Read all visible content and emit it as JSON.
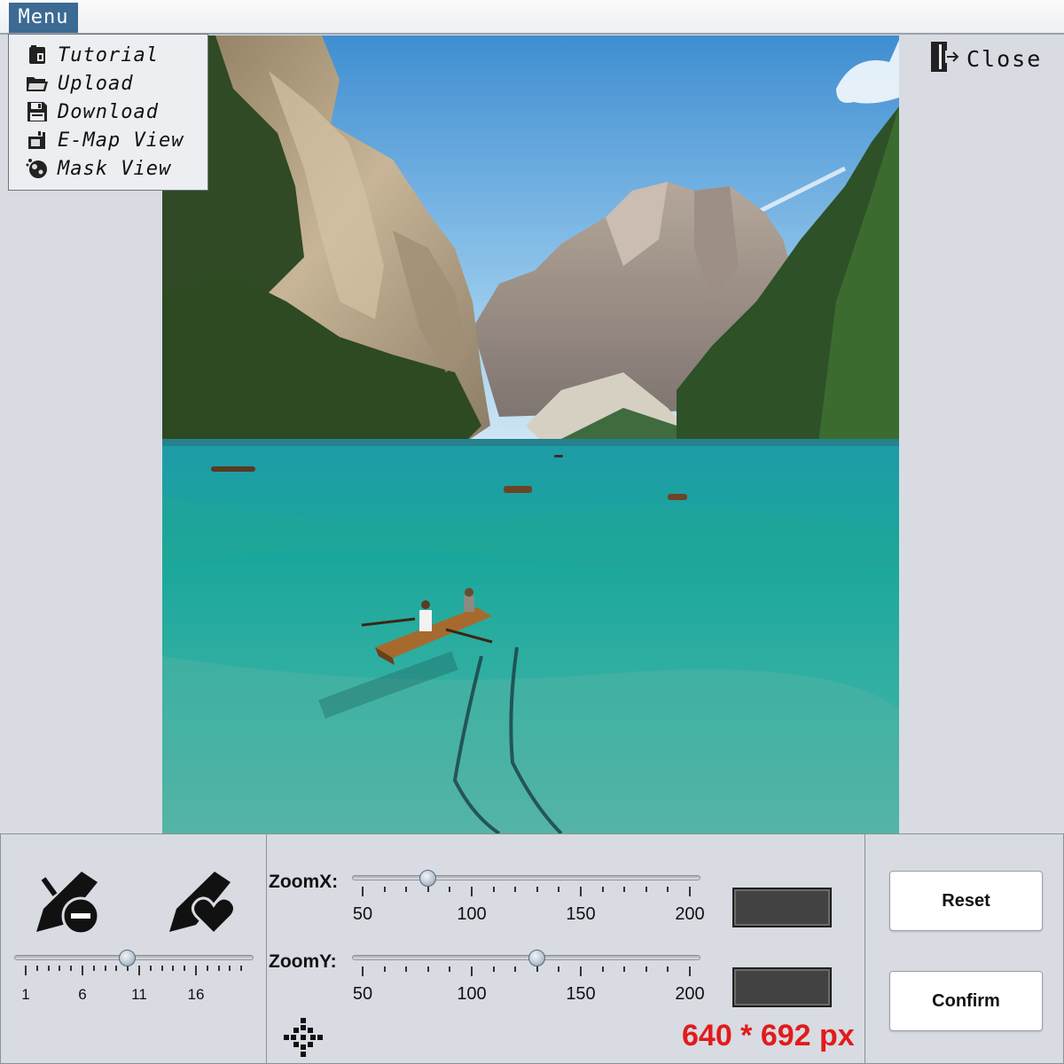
{
  "menu": {
    "label": "Menu",
    "items": [
      {
        "label": "Tutorial",
        "icon": "tutorial-icon"
      },
      {
        "label": "Upload",
        "icon": "folder-icon"
      },
      {
        "label": "Download",
        "icon": "floppy-disk-icon"
      },
      {
        "label": "E-Map View",
        "icon": "emap-icon"
      },
      {
        "label": "Mask View",
        "icon": "mask-icon"
      }
    ]
  },
  "close": {
    "label": "Close",
    "icon": "exit-door-icon"
  },
  "brush": {
    "erase_icon": "pen-minus-icon",
    "paint_icon": "pen-heart-icon",
    "size_slider": {
      "min": 1,
      "max": 20,
      "value": 10,
      "tick_labels": [
        "1",
        "6",
        "11",
        "16"
      ]
    }
  },
  "zoom": {
    "x": {
      "label": "ZoomX:",
      "min": 50,
      "max": 200,
      "value": 80,
      "tick_labels": [
        "50",
        "100",
        "150",
        "200"
      ]
    },
    "y": {
      "label": "ZoomY:",
      "min": 50,
      "max": 200,
      "value": 130,
      "tick_labels": [
        "50",
        "100",
        "150",
        "200"
      ]
    },
    "crosshair_icon": "move-crosshair-icon",
    "dimensions": "640 * 692 px",
    "colors": {
      "dimensions_text": "#e21b1b",
      "fields": "#424242"
    }
  },
  "actions": {
    "reset": "Reset",
    "confirm": "Confirm"
  },
  "colors": {
    "menu_accent": "#3c6a93",
    "background": "#d8dbe2"
  }
}
